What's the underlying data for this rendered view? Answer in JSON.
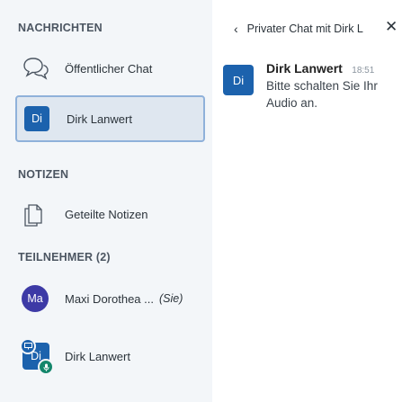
{
  "sidebar": {
    "messages_title": "NACHRICHTEN",
    "public_chat_label": "Öffentlicher Chat",
    "private_chat": {
      "initials": "Di",
      "label": "Dirk Lanwert"
    },
    "notes_title": "NOTIZEN",
    "shared_notes_label": "Geteilte Notizen",
    "participants_title": "TEILNEHMER (2)",
    "participants": [
      {
        "initials": "Ma",
        "name": "Maxi Dorothea ...",
        "suffix": "(Sie)"
      },
      {
        "initials": "Di",
        "name": "Dirk Lanwert"
      }
    ]
  },
  "chat": {
    "title": "Privater Chat mit Dirk L",
    "messages": [
      {
        "initials": "Di",
        "author": "Dirk Lanwert",
        "time": "18:51",
        "text": "Bitte schalten Sie Ihr Audio an."
      }
    ]
  },
  "colors": {
    "accent": "#1c62ad",
    "mic": "#13866b",
    "self_avatar": "#3d3aa6"
  }
}
